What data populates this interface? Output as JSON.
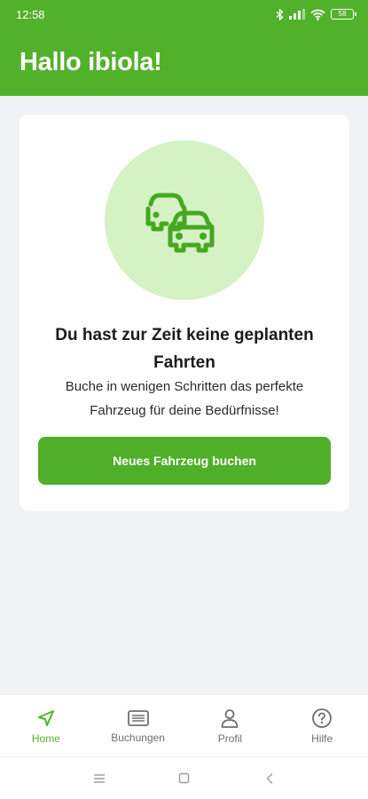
{
  "status_bar": {
    "time": "12:58",
    "battery": "58"
  },
  "header": {
    "title": "Hallo ibiola!"
  },
  "empty_state": {
    "illustration_icon": "cars-icon",
    "title": "Du hast zur Zeit keine geplanten Fahrten",
    "text": "Buche in wenigen Schritten das perfekte Fahrzeug für deine Bedürfnisse!",
    "button_label": "Neues Fahrzeug buchen"
  },
  "bottom_nav": {
    "items": [
      {
        "label": "Home",
        "icon": "navigation-arrow-icon",
        "active": true
      },
      {
        "label": "Buchungen",
        "icon": "list-icon",
        "active": false
      },
      {
        "label": "Profil",
        "icon": "person-icon",
        "active": false
      },
      {
        "label": "Hilfe",
        "icon": "help-icon",
        "active": false
      }
    ]
  },
  "colors": {
    "brand_green": "#52b12a",
    "illustration_bg": "#d4f2c4",
    "page_bg": "#f1f2f4"
  }
}
